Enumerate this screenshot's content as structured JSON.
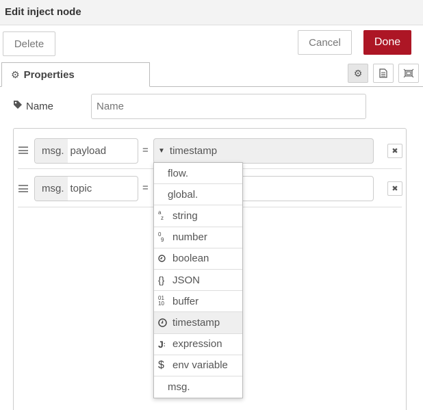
{
  "header": {
    "title": "Edit inject node"
  },
  "toolbar": {
    "delete_label": "Delete",
    "cancel_label": "Cancel",
    "done_label": "Done"
  },
  "tabs": [
    {
      "label": "Properties",
      "icon": "gear-icon"
    }
  ],
  "tab_tools": [
    "gear-icon",
    "document-icon",
    "layout-icon"
  ],
  "name_field": {
    "label": "Name",
    "icon": "tag-icon",
    "value": "",
    "placeholder": "Name"
  },
  "rows": [
    {
      "prefix": "msg.",
      "property": "payload",
      "equals": "=",
      "value_type": "timestamp"
    },
    {
      "prefix": "msg.",
      "property": "topic",
      "equals": "=",
      "value_type": ""
    }
  ],
  "type_dropdown": {
    "items": [
      {
        "label": "flow.",
        "icon": ""
      },
      {
        "label": "global.",
        "icon": ""
      },
      {
        "label": "string",
        "icon": "az-icon"
      },
      {
        "label": "number",
        "icon": "09-icon"
      },
      {
        "label": "boolean",
        "icon": "boolean-icon"
      },
      {
        "label": "JSON",
        "icon": "braces-icon"
      },
      {
        "label": "buffer",
        "icon": "binary-icon"
      },
      {
        "label": "timestamp",
        "icon": "clock-icon"
      },
      {
        "label": "expression",
        "icon": "jsonata-icon"
      },
      {
        "label": "env variable",
        "icon": "dollar-icon"
      },
      {
        "label": "msg.",
        "icon": ""
      }
    ],
    "selected": "timestamp"
  },
  "colors": {
    "done": "#ad1625",
    "header_bg": "#f3f3f3",
    "border": "#cccccc"
  }
}
